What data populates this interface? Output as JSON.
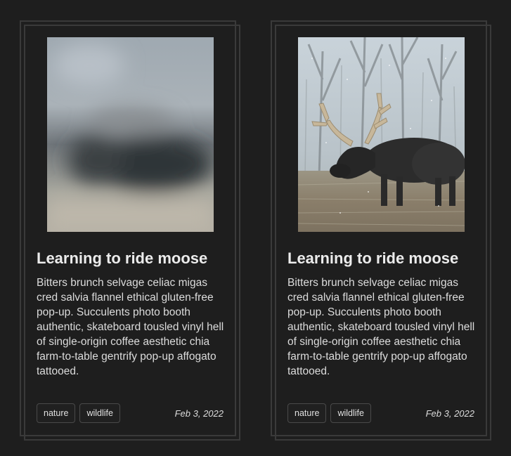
{
  "cards": [
    {
      "title": "Learning to ride moose",
      "body": "Bitters brunch selvage celiac migas cred salvia flannel ethical gluten-free pop-up. Succulents photo booth authentic, skateboard tousled vinyl hell of single-origin coffee aesthetic chia farm-to-table gentrify pop-up affogato tattooed.",
      "tags": [
        "nature",
        "wildlife"
      ],
      "date": "Feb 3, 2022",
      "image": "blurred-moose-photo"
    },
    {
      "title": "Learning to ride moose",
      "body": "Bitters brunch selvage celiac migas cred salvia flannel ethical gluten-free pop-up. Succulents photo booth authentic, skateboard tousled vinyl hell of single-origin coffee aesthetic chia farm-to-table gentrify pop-up affogato tattooed.",
      "tags": [
        "nature",
        "wildlife"
      ],
      "date": "Feb 3, 2022",
      "image": "moose-photo"
    }
  ],
  "colors": {
    "background": "#1e1e1e",
    "card_border": "#3a3a3a",
    "text": "#e6e6e6"
  }
}
